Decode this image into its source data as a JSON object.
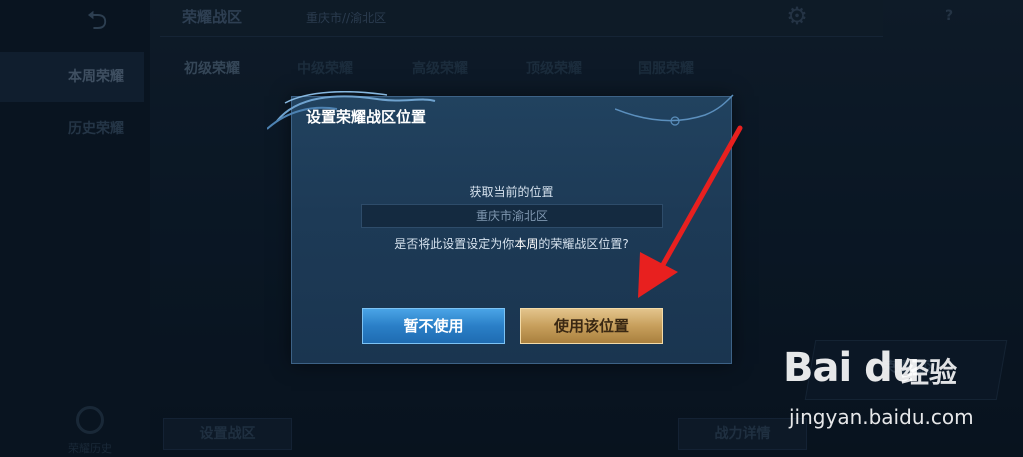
{
  "background": {
    "back_icon": "back-arrow-icon",
    "sidebar": {
      "items": [
        {
          "label": "本周荣耀",
          "active": true
        },
        {
          "label": "历史荣耀",
          "active": false
        }
      ]
    },
    "topbar": {
      "title": "荣耀战区",
      "location": "重庆市//渝北区",
      "gear_icon": "gear-icon",
      "help_label": "?"
    },
    "tabs": [
      {
        "label": "初级荣耀",
        "active": true
      },
      {
        "label": "中级荣耀",
        "active": false
      },
      {
        "label": "高级荣耀",
        "active": false
      },
      {
        "label": "顶级荣耀",
        "active": false
      },
      {
        "label": "国服荣耀",
        "active": false
      }
    ],
    "bottom": {
      "left_label": "荣耀历史",
      "set_zone_label": "设置战区",
      "power_detail_label": "战力详情",
      "honor_card_label": "荣耀战区"
    }
  },
  "dialog": {
    "title": "设置荣耀战区位置",
    "current_location_label": "获取当前的位置",
    "current_location_value": "重庆市渝北区",
    "question_prefix": "是否将此设置设定为你",
    "question_highlight": "本周",
    "question_suffix": "的荣耀战区位置?",
    "cancel_label": "暂不使用",
    "confirm_label": "使用该位置"
  },
  "watermark": {
    "logo": "Bai du",
    "brand": "经验",
    "url": "jingyan.baidu.com"
  },
  "colors": {
    "confirm_gold": "#c79f5c",
    "cancel_blue": "#2a7fc7",
    "annotation_red": "#e8201f"
  }
}
